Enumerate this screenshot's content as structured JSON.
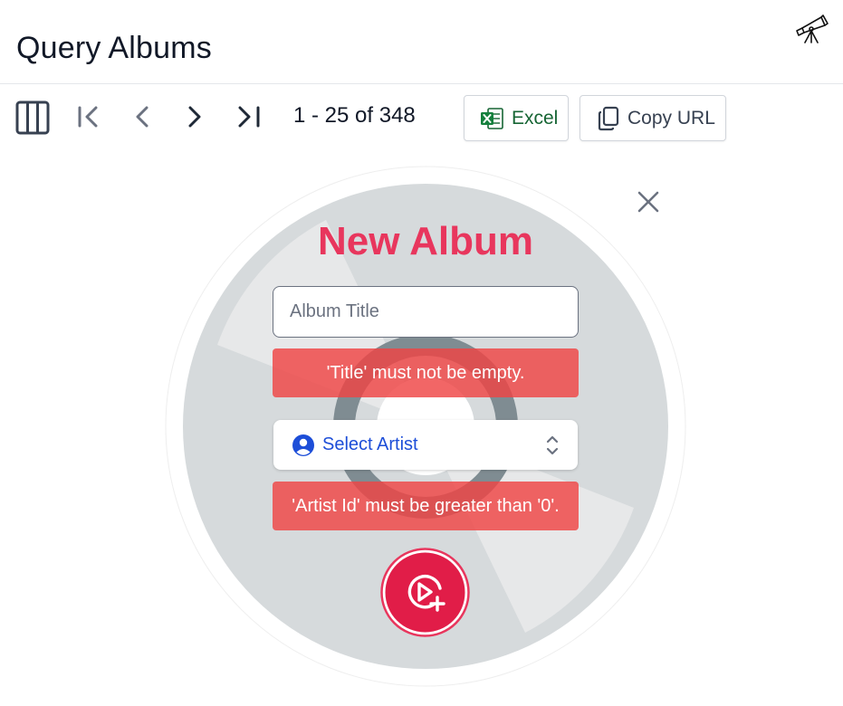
{
  "header": {
    "title": "Query Albums",
    "icon": "telescope-icon"
  },
  "toolbar": {
    "paging_text": "1 - 25 of 348",
    "excel_label": "Excel",
    "copy_url_label": "Copy URL",
    "icons": [
      "columns-icon",
      "first-page-icon",
      "prev-page-icon",
      "next-page-icon",
      "last-page-icon"
    ]
  },
  "form": {
    "title": "New Album",
    "album_title_placeholder": "Album Title",
    "title_error": "'Title' must not be empty.",
    "artist_select_label": "Select Artist",
    "artist_error": "'Artist Id' must be greater than '0'.",
    "submit_icon": "play-plus-icon",
    "close_icon": "close-icon"
  },
  "colors": {
    "accent": "#e8365d",
    "error_bg": "#ef4444",
    "link_blue": "#1d4ed8",
    "excel_green": "#166534",
    "disc": "#d6dadc"
  }
}
